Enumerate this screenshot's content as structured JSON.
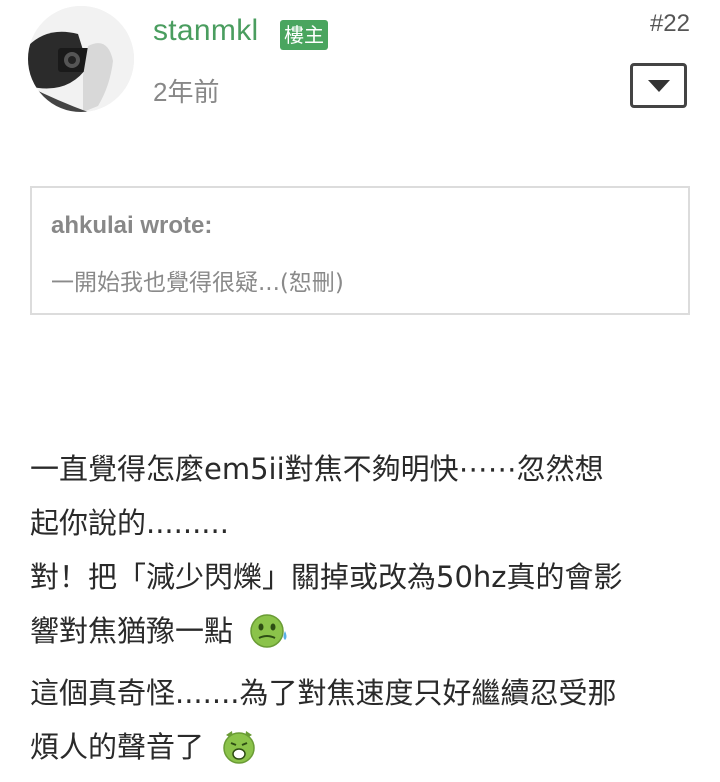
{
  "post": {
    "author": "stanmkl",
    "badge": "樓主",
    "time": "2年前",
    "number": "#22"
  },
  "quote": {
    "author_line": "ahkulai wrote:",
    "text": "一開始我也覺得很疑...(恕刪)"
  },
  "content": {
    "line1": "一直覺得怎麼em5ii對焦不夠明快⋯⋯忽然想",
    "line2": "起你說的.........",
    "line3": "對！把「減少閃爍」關掉或改為50hz真的會影",
    "line4": "響對焦猶豫一點",
    "line5": "這個真奇怪.......為了對焦速度只好繼續忍受那",
    "line6": "煩人的聲音了"
  },
  "icons": {
    "avatar": "avatar-photo",
    "menu": "dropdown-arrow-icon",
    "emoji1": "sweat-smiley-icon",
    "emoji2": "crying-smiley-icon"
  },
  "colors": {
    "username": "#4a9d5f",
    "badge": "#4aa55f",
    "quote_border": "#dcdcdc",
    "emoji": "#8bc34a"
  }
}
